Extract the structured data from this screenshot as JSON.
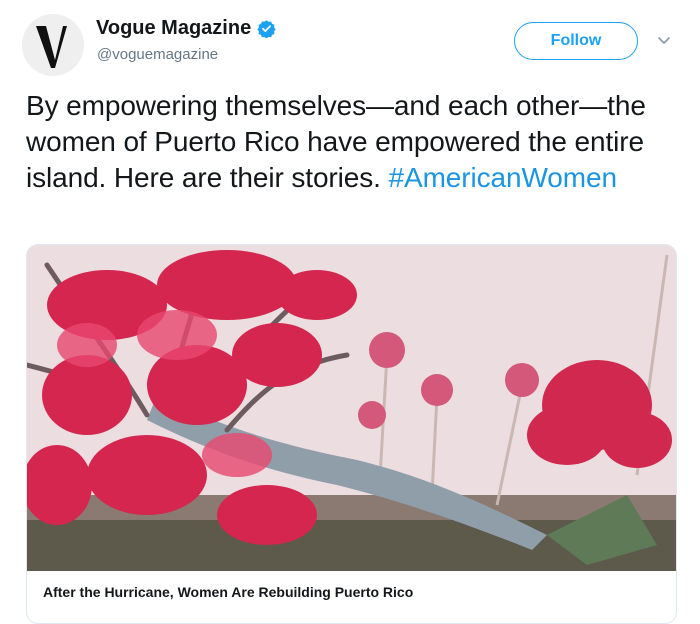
{
  "account": {
    "display_name": "Vogue Magazine",
    "handle": "@voguemagazine",
    "verified_icon": "verified-badge-icon",
    "avatar_letter": "V"
  },
  "actions": {
    "follow_label": "Follow",
    "more_icon": "chevron-down-icon"
  },
  "tweet": {
    "text": "By empowering themselves—and each other—the women of Puerto Rico have empowered the entire island. Here are their stories.",
    "hashtag": "#AmericanWomen"
  },
  "card": {
    "image_description_icon": "photo-fallen-tree-icon",
    "title": "After the Hurricane, Women Are Rebuilding Puerto Rico"
  },
  "colors": {
    "accent": "#1da1f2",
    "hashtag": "#1b95e0",
    "text": "#14171a",
    "secondary_text": "#657786",
    "border": "#e1e8ed"
  }
}
